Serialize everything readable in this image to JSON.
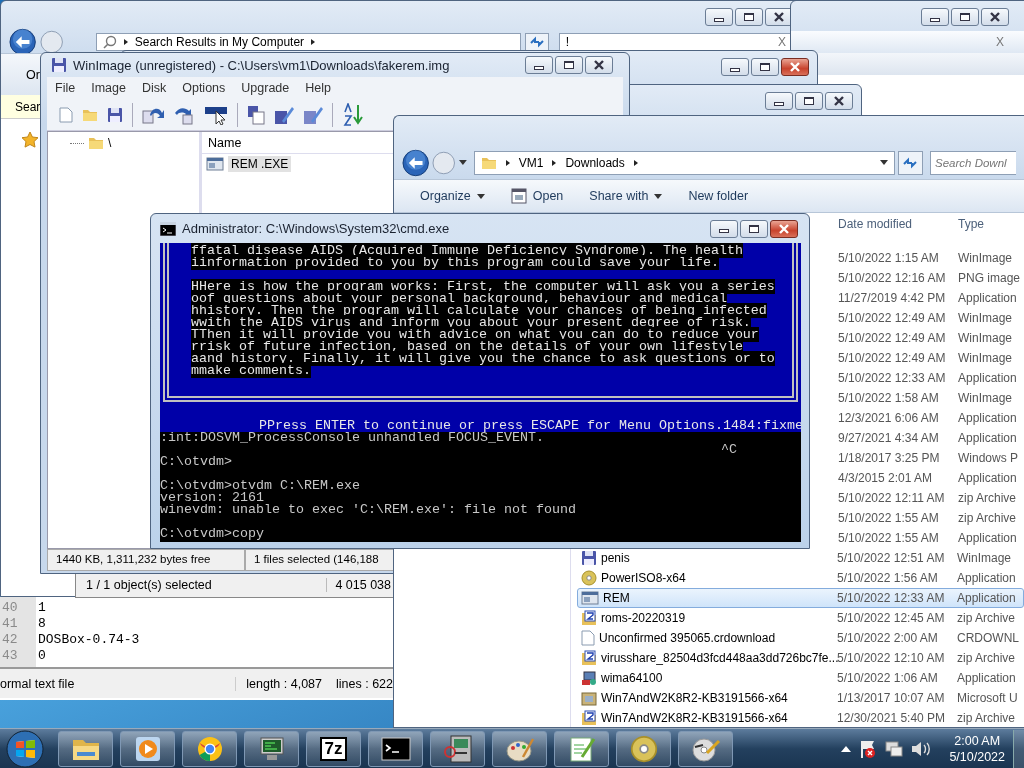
{
  "search_window": {
    "active": false,
    "address": "Search Results in My Computer",
    "search_value": "!",
    "clear_label": "X",
    "toolbar_label": "Or",
    "info_label": "Sear"
  },
  "right_window": {
    "active": false,
    "clear_label": "X"
  },
  "back_windows": [
    {
      "active": true
    },
    {
      "active": false
    }
  ],
  "notepad": {
    "lines": [
      {
        "number": "40",
        "text": "1"
      },
      {
        "number": "41",
        "text": "8"
      },
      {
        "number": "42",
        "text": "DOSBox-0.74-3"
      },
      {
        "number": "43",
        "text": "0"
      }
    ],
    "status": [
      "ormal text file",
      "length : 4,087",
      "lines : 622"
    ]
  },
  "archive_window": {
    "status": "1 / 1 object(s) selected",
    "size": "4 015 038"
  },
  "winimage": {
    "active": false,
    "title": "WinImage (unregistered) - C:\\Users\\vm1\\Downloads\\fakerem.img",
    "menu": [
      "File",
      "Image",
      "Disk",
      "Options",
      "Upgrade",
      "Help"
    ],
    "tree_root": "\\",
    "column": "Name",
    "files": [
      {
        "name": "REM .EXE",
        "selected": true
      }
    ],
    "status": [
      "1440 KB, 1,311,232 bytes free",
      "1 files selected (146,188"
    ]
  },
  "explorer": {
    "breadcrumb": [
      "VM1",
      "Downloads"
    ],
    "search": {
      "placeholder": "Search Downl"
    },
    "toolbar": [
      {
        "label": "Organize",
        "kind": "dropdown"
      },
      {
        "label": "Open",
        "kind": "icon"
      },
      {
        "label": "Share with",
        "kind": "dropdown"
      },
      {
        "label": "New folder",
        "kind": "plain"
      }
    ],
    "columns": [
      "Date modified",
      "Type"
    ],
    "rows": [
      {
        "date": "5/10/2022 1:15 AM",
        "type": "WinImage",
        "selected": false
      },
      {
        "date": "5/10/2022 12:16 AM",
        "type": "PNG image",
        "selected": false
      },
      {
        "date": "11/27/2019 4:42 PM",
        "type": "Application",
        "selected": false
      },
      {
        "date": "5/10/2022 12:49 AM",
        "type": "WinImage",
        "selected": false
      },
      {
        "date": "5/10/2022 12:49 AM",
        "type": "WinImage",
        "selected": false
      },
      {
        "date": "5/10/2022 12:49 AM",
        "type": "WinImage",
        "selected": false
      },
      {
        "date": "5/10/2022 12:33 AM",
        "type": "Application",
        "selected": false
      },
      {
        "date": "5/10/2022 1:58 AM",
        "type": "WinImage",
        "selected": false
      },
      {
        "date": "12/3/2021 6:06 AM",
        "type": "Application",
        "selected": false
      },
      {
        "date": "9/27/2021 4:34 AM",
        "type": "Application",
        "selected": false
      },
      {
        "date": "1/18/2017 3:25 PM",
        "type": "Windows P",
        "selected": false
      },
      {
        "date": "4/3/2015 2:01 AM",
        "type": "Application",
        "selected": false
      },
      {
        "date": "5/10/2022 12:11 AM",
        "type": "zip Archive",
        "selected": false
      },
      {
        "date": "5/10/2022 1:55 AM",
        "type": "zip Archive",
        "selected": false
      },
      {
        "date": "5/10/2022 1:55 AM",
        "type": "Application",
        "selected": false
      },
      {
        "name": "penis",
        "kind": "image",
        "date": "5/10/2022 12:51 AM",
        "type": "WinImage",
        "selected": false
      },
      {
        "name": "PowerISO8-x64",
        "kind": "installer",
        "date": "5/10/2022 1:56 AM",
        "type": "Application",
        "selected": false
      },
      {
        "name": "REM",
        "kind": "program",
        "date": "5/10/2022 12:33 AM",
        "type": "Application",
        "selected": true
      },
      {
        "name": "roms-20220319",
        "kind": "zip",
        "date": "5/10/2022 12:45 AM",
        "type": "zip Archive",
        "selected": false
      },
      {
        "name": "Unconfirmed 395065.crdownload",
        "kind": "blank",
        "date": "5/10/2022 2:00 AM",
        "type": "CRDOWNL",
        "selected": false
      },
      {
        "name": "virusshare_82504d3fcd448aa3dd726bc7fe...",
        "kind": "zip",
        "date": "5/10/2022 12:10 AM",
        "type": "zip Archive",
        "selected": false
      },
      {
        "name": "wima64100",
        "kind": "setup",
        "date": "5/10/2022 1:06 AM",
        "type": "Application",
        "selected": false
      },
      {
        "name": "Win7AndW2K8R2-KB3191566-x64",
        "kind": "update",
        "date": "1/13/2017 10:07 AM",
        "type": "Microsoft U",
        "selected": false
      },
      {
        "name": "Win7AndW2K8R2-KB3191566-x64",
        "kind": "zip",
        "date": "12/30/2021 5:40 PM",
        "type": "zip Archive",
        "selected": false
      }
    ]
  },
  "console": {
    "active": true,
    "title": "Administrator: C:\\Windows\\System32\\cmd.exe",
    "screen_lines": [
      {
        "text": "ffatal disease AIDS (Acquired Immune Deficiency Syndrome). The health"
      },
      {
        "text": "iinformation provided to you by this program could save your life."
      },
      {
        "text": "HHere is how the program works: First, the computer will ask you a series",
        "blank_before": true
      },
      {
        "text": "oof questions about your personal background, behaviour and medical"
      },
      {
        "text": "hhistory. Then the program will calculate your chances of being infected"
      },
      {
        "text": "wwith the AIDS virus and inform you about your present degree of risk."
      },
      {
        "text": "TThen it will provide you with advice on what you can do to reduce your"
      },
      {
        "text": "rrisk of future infection, based on the details of your own lifestyle"
      },
      {
        "text": "aand history. Finally, it will give you the chance to ask questions or to"
      },
      {
        "text": "mmake comments."
      }
    ],
    "prompt": "PPress ENTER to continue or press ESCAPE for Menu Options.1484:fixme",
    "output_lines": [
      {
        "kind": "text",
        "text": ":int:DOSVM_ProcessConsole unhandled FOCUS_EVENT."
      },
      {
        "kind": "echo",
        "text": "^C"
      },
      {
        "kind": "text",
        "text": "C:\\otvdm>"
      },
      {
        "kind": "text",
        "text": "C:\\otvdm>otvdm C:\\REM.exe",
        "blank_before": true
      },
      {
        "kind": "text",
        "text": "version: 2161"
      },
      {
        "kind": "text",
        "text": "winevdm: unable to exec 'C:\\REM.exe': file not found"
      },
      {
        "kind": "text",
        "text": "C:\\otvdm>copy",
        "blank_before": true
      }
    ]
  },
  "taskbar": {
    "apps": [
      {
        "kind": "folder"
      },
      {
        "kind": "player"
      },
      {
        "kind": "browser"
      },
      {
        "kind": "monitor"
      },
      {
        "kind": "archiver",
        "label": "7z"
      },
      {
        "kind": "console"
      },
      {
        "kind": "computer"
      },
      {
        "kind": "paint"
      },
      {
        "kind": "editor"
      },
      {
        "kind": "disc"
      },
      {
        "kind": "tool"
      }
    ],
    "clock": {
      "time": "2:00 AM",
      "date": "5/10/2022"
    }
  }
}
